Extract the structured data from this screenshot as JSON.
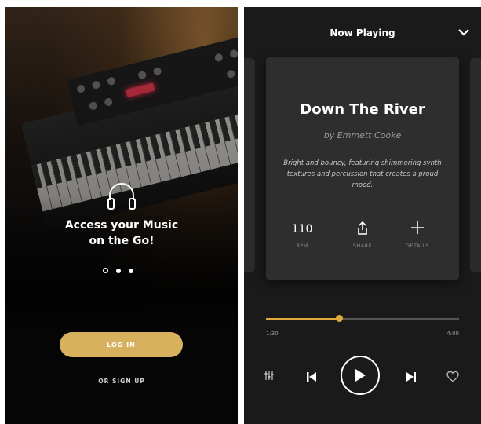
{
  "onboarding": {
    "headline_line1": "Access your Music",
    "headline_line2": "on the Go!",
    "pager": {
      "pages": 3,
      "active_index": 0
    },
    "login_label": "LOG IN",
    "signup_label": "OR SIGN UP",
    "accent": "#d8b15e"
  },
  "player": {
    "header_title": "Now Playing",
    "song_title": "Down The River",
    "artist_line": "by Emmett Cooke",
    "description": "Bright and bouncy, featuring shimmering synth textures and percussion that creates a proud mood.",
    "bpm_value": "110",
    "bpm_label": "BPM",
    "share_label": "SHARE",
    "details_label": "DETAILS",
    "progress_fraction": 0.38,
    "elapsed": "1:30",
    "duration": "4:00",
    "accent": "#e0a93a"
  }
}
